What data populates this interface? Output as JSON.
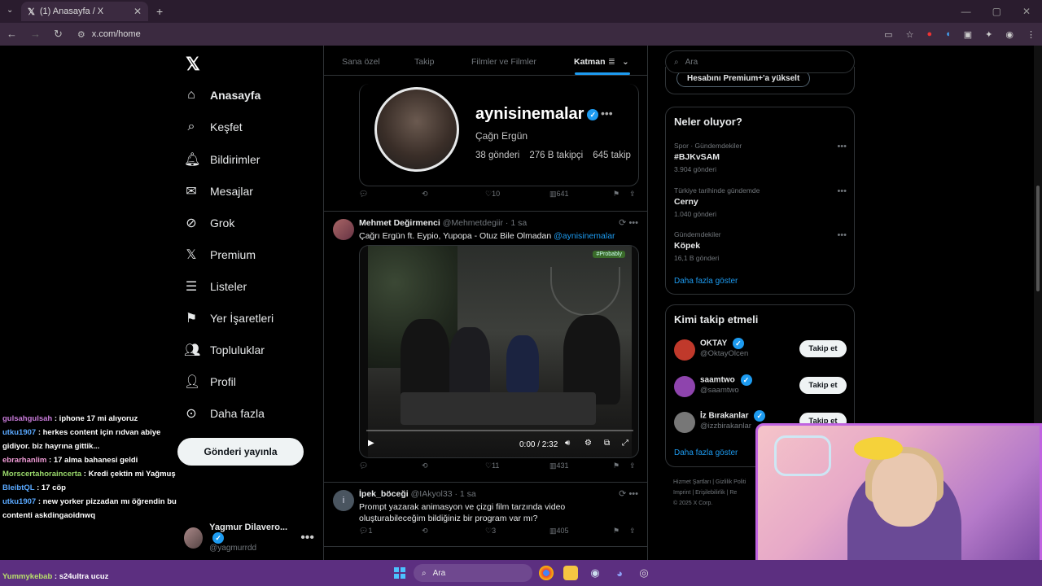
{
  "browser": {
    "tab_title": "(1) Anasayfa / X",
    "url": "x.com/home"
  },
  "nav": {
    "items": [
      {
        "label": "Anasayfa",
        "icon": "home-icon"
      },
      {
        "label": "Keşfet",
        "icon": "search-icon"
      },
      {
        "label": "Bildirimler",
        "icon": "bell-icon"
      },
      {
        "label": "Mesajlar",
        "icon": "mail-icon"
      },
      {
        "label": "Grok",
        "icon": "grok-icon"
      },
      {
        "label": "Premium",
        "icon": "x-logo-icon"
      },
      {
        "label": "Listeler",
        "icon": "list-icon"
      },
      {
        "label": "Yer İşaretleri",
        "icon": "bookmark-icon"
      },
      {
        "label": "Topluluklar",
        "icon": "people-icon"
      },
      {
        "label": "Profil",
        "icon": "user-icon"
      },
      {
        "label": "Daha fazla",
        "icon": "more-icon"
      }
    ],
    "post_button": "Gönderi yayınla",
    "user_name": "Yagmur Dilavero...",
    "user_handle": "@yagmurrdd"
  },
  "feed": {
    "tabs": [
      "Sana özel",
      "Takip",
      "Filmler ve Filmler",
      "Katman"
    ],
    "profile_card": {
      "name": "aynisinemalar",
      "subtitle": "Çağn Ergün",
      "posts": "38 gönderi",
      "followers": "276 B takipçi",
      "following": "645 takip"
    },
    "post1_actions": {
      "likes": "10",
      "views": "641"
    },
    "post2": {
      "author": "Mehmet Değirmenci",
      "handle": "@Mehmetdegiir",
      "time": "· 1 sa",
      "text": "Çağrı Ergün ft. Eypio, Yupopa - Otuz Bile Olmadan",
      "mention": "@aynisinemalar",
      "video_time": "0:00 / 2:32",
      "badge": "#Probably",
      "likes": "11",
      "views": "431"
    },
    "post3": {
      "author": "İpek_böceği",
      "handle": "@IAkyol33",
      "time": "· 1 sa",
      "avatar_letter": "i",
      "text": "Prompt yazarak animasyon ve çizgi film tarzında video oluşturabileceğim bildiğiniz bir program var mı?",
      "replies": "1",
      "likes": "3",
      "views": "405"
    }
  },
  "right": {
    "search_placeholder": "Ara",
    "premium_button": "Hesabını Premium+'a yükselt",
    "trends_title": "Neler oluyor?",
    "trends": [
      {
        "category": "Spor · Gündemdekiler",
        "title": "#BJKvSAM",
        "count": "3.904 gönderi"
      },
      {
        "category": "Türkiye tarihinde gündemde",
        "title": "Cerny",
        "count": "1.040 gönderi"
      },
      {
        "category": "Gündemdekiler",
        "title": "Köpek",
        "count": "16,1 B gönderi"
      }
    ],
    "show_more": "Daha fazla göster",
    "who_title": "Kimi takip etmeli",
    "who": [
      {
        "name": "OKTAY",
        "handle": "@OktayOlcen",
        "button": "Takip et",
        "color": "#c0392b"
      },
      {
        "name": "saamtwo",
        "handle": "@saamtwo",
        "button": "Takip et",
        "color": "#8e44ad"
      },
      {
        "name": "İz Bırakanlar",
        "handle": "@izzbirakanlar",
        "button": "Takip et",
        "color": "#777777"
      }
    ],
    "who_more": "Daha fazla göster",
    "footer_1": "Hizmet Şartları  |  Gizlilik Politi",
    "footer_2": "Imprint  |  Erişilebilirlik  |  Re",
    "footer_3": "© 2025 X Corp."
  },
  "chat": [
    {
      "user": "gulsahgulsah",
      "msg": ": iphone 17 mi alıyoruz",
      "cls": "u1"
    },
    {
      "user": "utku1907",
      "msg": ": herkes content için rıdvan abiye gidiyor. biz hayrına gittik...",
      "cls": "u2"
    },
    {
      "user": "ebrarhanlim",
      "msg": ": 17 alma bahanesi geldi",
      "cls": "u3"
    },
    {
      "user": "Morscertahoraincerta",
      "msg": ": Kredi çektin mi Yağmuş",
      "cls": "u4"
    },
    {
      "user": "BleibtQL",
      "msg": ": 17 cöp",
      "cls": "u2"
    },
    {
      "user": "utku1907",
      "msg": ": new yorker pizzadan mı öğrendin bu contenti askdingaoidnwq",
      "cls": "u2"
    }
  ],
  "chat_bottom": {
    "user": "Yummykebab",
    "msg": ": s24ultra ucuz"
  },
  "taskbar": {
    "search": "Ara"
  }
}
